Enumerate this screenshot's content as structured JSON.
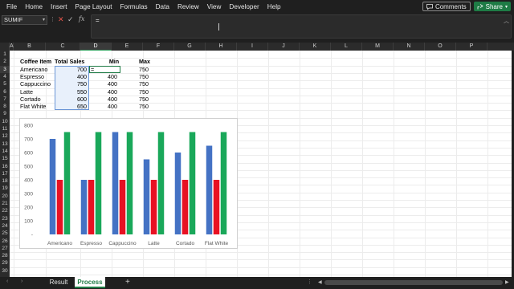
{
  "menu": [
    "File",
    "Home",
    "Insert",
    "Page Layout",
    "Formulas",
    "Data",
    "Review",
    "View",
    "Developer",
    "Help"
  ],
  "buttons": {
    "comments": "Comments",
    "share": "Share"
  },
  "formula_bar": {
    "name_box": "SUMIF",
    "content": "="
  },
  "columns": [
    "A",
    "B",
    "C",
    "D",
    "E",
    "F",
    "G",
    "H",
    "I",
    "J",
    "K",
    "L",
    "M",
    "N",
    "O",
    "P"
  ],
  "active_column": "D",
  "rows": [
    "1",
    "2",
    "3",
    "4",
    "5",
    "6",
    "7",
    "8",
    "9",
    "10",
    "11",
    "12",
    "13",
    "14",
    "15",
    "16",
    "17",
    "18",
    "19",
    "20",
    "21",
    "22",
    "23",
    "24",
    "25",
    "26",
    "27",
    "28",
    "29",
    "30"
  ],
  "active_row": "3",
  "table": {
    "headers": [
      "Coffee Item",
      "Total Sales",
      "Min",
      "Max"
    ],
    "items": [
      {
        "name": "Americano",
        "sales": "700",
        "min": "=",
        "max": "750"
      },
      {
        "name": "Espresso",
        "sales": "400",
        "min": "400",
        "max": "750"
      },
      {
        "name": "Cappuccino",
        "sales": "750",
        "min": "400",
        "max": "750"
      },
      {
        "name": "Latte",
        "sales": "550",
        "min": "400",
        "max": "750"
      },
      {
        "name": "Cortado",
        "sales": "600",
        "min": "400",
        "max": "750"
      },
      {
        "name": "Flat White",
        "sales": "650",
        "min": "400",
        "max": "750"
      }
    ]
  },
  "chart_data": {
    "type": "bar",
    "categories": [
      "Americano",
      "Espresso",
      "Cappuccino",
      "Latte",
      "Cortado",
      "Flat White"
    ],
    "series": [
      {
        "values": [
          700,
          400,
          750,
          550,
          600,
          650
        ],
        "color": "#4472c4"
      },
      {
        "values": [
          400,
          400,
          400,
          400,
          400,
          400
        ],
        "color": "#e81123"
      },
      {
        "values": [
          750,
          750,
          750,
          750,
          750,
          750
        ],
        "color": "#1aa85a"
      }
    ],
    "y_ticks": [
      "800",
      "700",
      "600",
      "500",
      "400",
      "300",
      "200",
      "100",
      "-"
    ],
    "ylim": [
      0,
      800
    ],
    "grid": false
  },
  "sheet_tabs": {
    "tabs": [
      "Result",
      "Process"
    ],
    "active": "Process"
  },
  "colors": {
    "accent": "#1e7b45",
    "share": "#1e7b45",
    "highlight": "#e8f0fb"
  }
}
